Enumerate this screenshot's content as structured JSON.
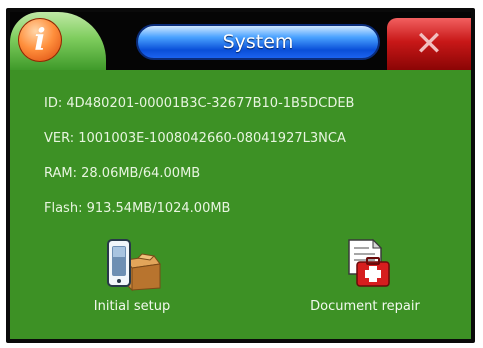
{
  "window": {
    "title": "System",
    "info_glyph": "i",
    "close_glyph": "✕"
  },
  "system_info": {
    "id": "ID: 4D480201-00001B3C-32677B10-1B5DCDEB",
    "ver": "VER: 1001003E-1008042660-08041927L3NCA",
    "ram": "RAM: 28.06MB/64.00MB",
    "flash": "Flash: 913.54MB/1024.00MB"
  },
  "actions": {
    "initial_setup": {
      "label": "Initial setup",
      "icon": "device-setup-icon"
    },
    "document_repair": {
      "label": "Document repair",
      "icon": "document-repair-icon"
    }
  },
  "colors": {
    "panel_green": "#3d9125",
    "title_blue": "#0a4fd8",
    "close_red": "#c81818",
    "info_orange": "#ff8f3c"
  }
}
